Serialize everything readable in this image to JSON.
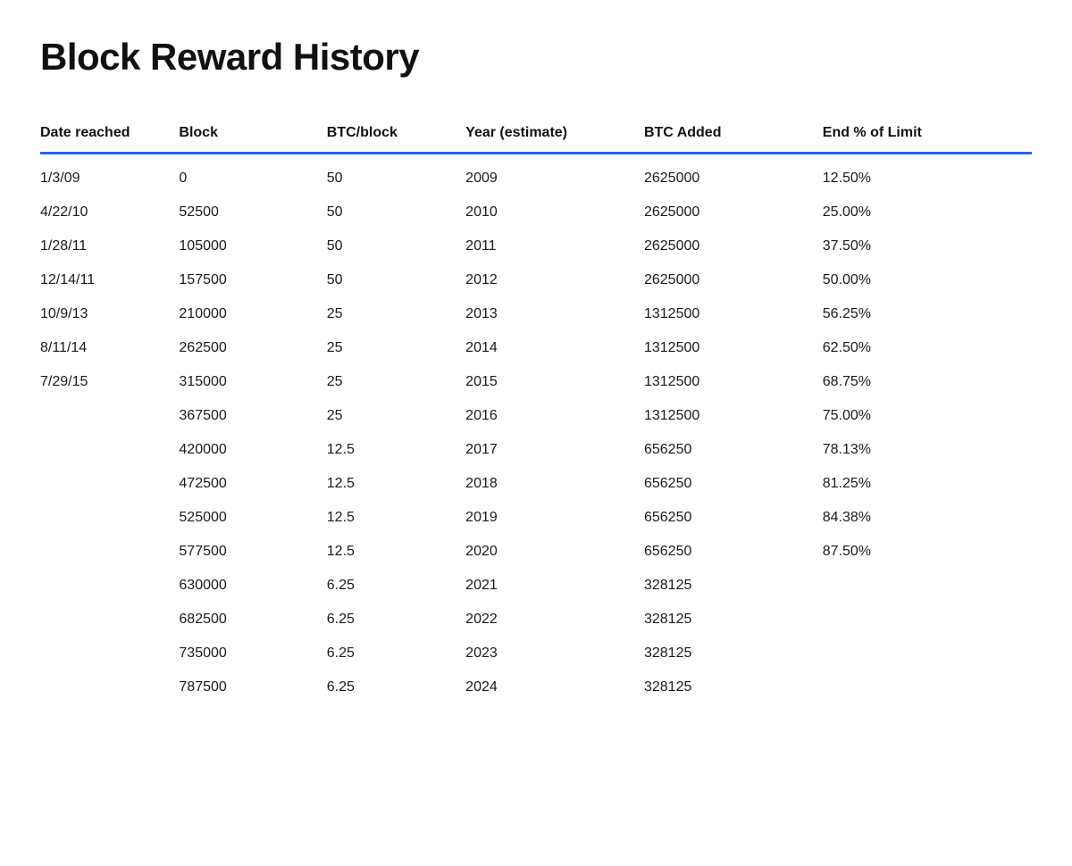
{
  "title": "Block Reward History",
  "table": {
    "headers": [
      {
        "id": "date",
        "label": "Date reached"
      },
      {
        "id": "block",
        "label": "Block"
      },
      {
        "id": "btcblock",
        "label": "BTC/block"
      },
      {
        "id": "year",
        "label": "Year (estimate)"
      },
      {
        "id": "btcadded",
        "label": "BTC Added"
      },
      {
        "id": "endlimit",
        "label": "End % of Limit"
      }
    ],
    "rows": [
      {
        "date": "1/3/09",
        "block": "0",
        "btcblock": "50",
        "year": "2009",
        "btcadded": "2625000",
        "endlimit": "12.50%"
      },
      {
        "date": "4/22/10",
        "block": "52500",
        "btcblock": "50",
        "year": "2010",
        "btcadded": "2625000",
        "endlimit": "25.00%"
      },
      {
        "date": "1/28/11",
        "block": "105000",
        "btcblock": "50",
        "year": "2011",
        "btcadded": "2625000",
        "endlimit": "37.50%"
      },
      {
        "date": "12/14/11",
        "block": "157500",
        "btcblock": "50",
        "year": "2012",
        "btcadded": "2625000",
        "endlimit": "50.00%"
      },
      {
        "date": "10/9/13",
        "block": "210000",
        "btcblock": "25",
        "year": "2013",
        "btcadded": "1312500",
        "endlimit": "56.25%"
      },
      {
        "date": "8/11/14",
        "block": "262500",
        "btcblock": "25",
        "year": "2014",
        "btcadded": "1312500",
        "endlimit": "62.50%"
      },
      {
        "date": "7/29/15",
        "block": "315000",
        "btcblock": "25",
        "year": "2015",
        "btcadded": "1312500",
        "endlimit": "68.75%"
      },
      {
        "date": "",
        "block": "367500",
        "btcblock": "25",
        "year": "2016",
        "btcadded": "1312500",
        "endlimit": "75.00%"
      },
      {
        "date": "",
        "block": "420000",
        "btcblock": "12.5",
        "year": "2017",
        "btcadded": "656250",
        "endlimit": "78.13%"
      },
      {
        "date": "",
        "block": "472500",
        "btcblock": "12.5",
        "year": "2018",
        "btcadded": "656250",
        "endlimit": "81.25%"
      },
      {
        "date": "",
        "block": "525000",
        "btcblock": "12.5",
        "year": "2019",
        "btcadded": "656250",
        "endlimit": "84.38%"
      },
      {
        "date": "",
        "block": "577500",
        "btcblock": "12.5",
        "year": "2020",
        "btcadded": "656250",
        "endlimit": "87.50%"
      },
      {
        "date": "",
        "block": "630000",
        "btcblock": "6.25",
        "year": "2021",
        "btcadded": "328125",
        "endlimit": ""
      },
      {
        "date": "",
        "block": "682500",
        "btcblock": "6.25",
        "year": "2022",
        "btcadded": "328125",
        "endlimit": ""
      },
      {
        "date": "",
        "block": "735000",
        "btcblock": "6.25",
        "year": "2023",
        "btcadded": "328125",
        "endlimit": ""
      },
      {
        "date": "",
        "block": "787500",
        "btcblock": "6.25",
        "year": "2024",
        "btcadded": "328125",
        "endlimit": ""
      }
    ]
  }
}
